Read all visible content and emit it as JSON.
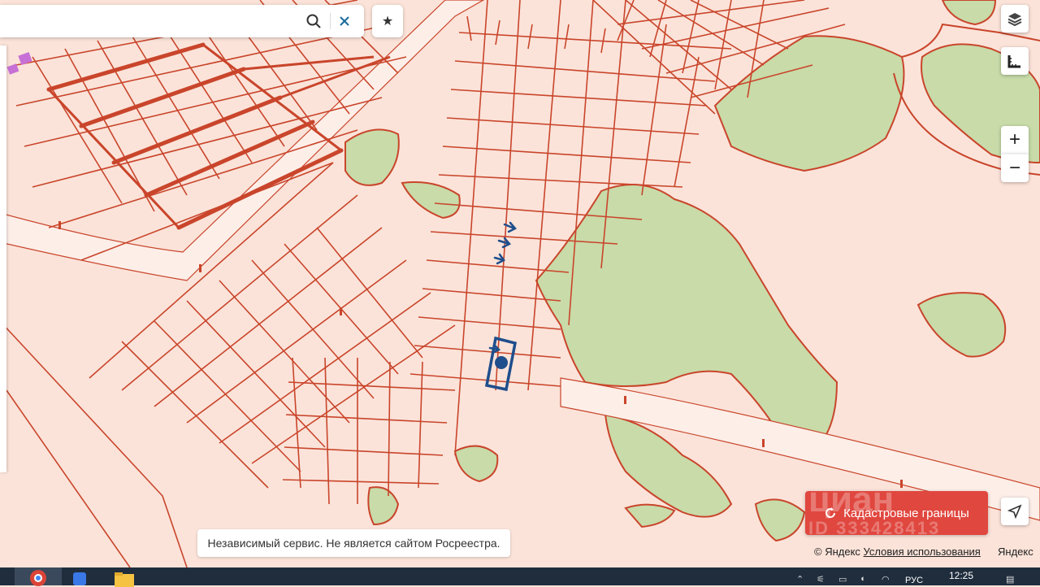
{
  "search": {
    "placeholder": "",
    "value": ""
  },
  "icons": {
    "search": "search-icon",
    "clear": "close-icon",
    "favorite": "star-icon",
    "layers": "layers-icon",
    "ruler": "ruler-icon",
    "zoom_in": "plus-icon",
    "zoom_out": "minus-icon",
    "locate": "locate-icon",
    "refresh": "refresh-icon"
  },
  "controls": {
    "zoom_in_label": "+",
    "zoom_out_label": "−"
  },
  "cadastral_button": {
    "label": "Кадастровые границы"
  },
  "watermark": {
    "brand": "циан",
    "id": "ID 333428413"
  },
  "notice": "Независимый сервис. Не является сайтом Росреестра.",
  "attribution": {
    "copyright": "© Яндекс",
    "terms": "Условия использования",
    "brand": "Яндекс"
  },
  "taskbar": {
    "time": "12:25",
    "lang": "РУС"
  },
  "colors": {
    "map_background": "#fbe3d9",
    "parcel_lines": "#c9452b",
    "forest": "#c8dba9",
    "selected_parcel": "#1f4e8c",
    "cadastral_button": "#e0473f",
    "road": "#fdeee8"
  }
}
